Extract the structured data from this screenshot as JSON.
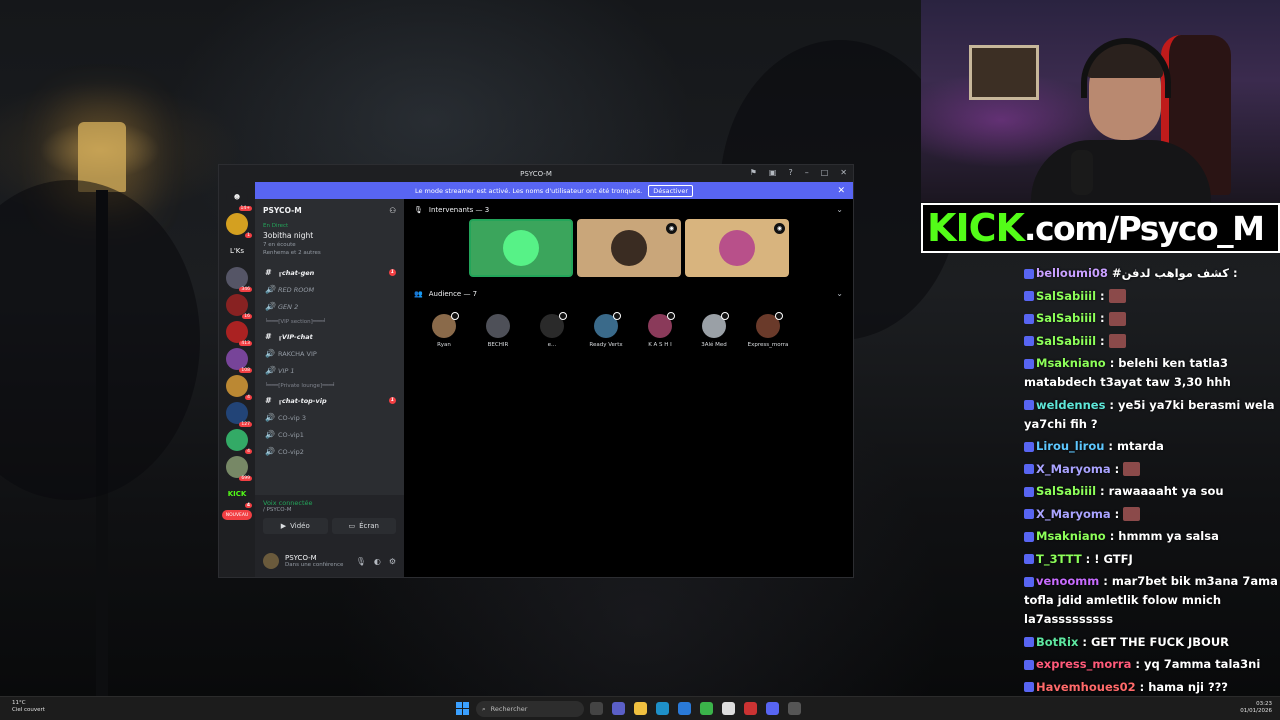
{
  "window": {
    "title": "PSYCO-M",
    "banner_text": "Le mode streamer est activé. Les noms d'utilisateur ont été tronqués.",
    "banner_button": "Désactiver"
  },
  "rail": {
    "items": [
      {
        "badge": "14+"
      },
      {
        "badge": "1"
      },
      {
        "label": "L'Ks"
      },
      {
        "badge": "346"
      },
      {
        "badge": "16"
      },
      {
        "badge": "413"
      },
      {
        "badge": "108"
      },
      {
        "badge": "4"
      },
      {
        "badge": "127"
      },
      {
        "badge": "4"
      },
      {
        "badge": "699"
      },
      {
        "label": "KICK",
        "badge": "4"
      },
      {
        "label": "NOUVEAU"
      }
    ]
  },
  "sidebar": {
    "server_name": "PSYCO-M",
    "event": {
      "status": "En Direct",
      "title": "3obitha night",
      "listening": "7 en écoute",
      "listeners": "Renhema et 2 autres"
    },
    "channels": [
      {
        "type": "text",
        "name": "╓chat-gen",
        "unread": "1",
        "style": "bold"
      },
      {
        "type": "voice",
        "name": "RED ROOM",
        "style": "italic"
      },
      {
        "type": "voice",
        "name": "GEN 2",
        "style": "italic"
      },
      {
        "type": "category",
        "name": "╘═══[VIP section]═══╛"
      },
      {
        "type": "text",
        "name": "╓VIP-chat",
        "style": "bold"
      },
      {
        "type": "voice",
        "name": "RAKCHA VIP"
      },
      {
        "type": "voice",
        "name": "VIP 1",
        "style": "italic"
      },
      {
        "type": "category",
        "name": "╘═══[Private lounge]═══╛"
      },
      {
        "type": "text",
        "name": "╓chat-top-vip",
        "unread": "1",
        "style": "bold"
      },
      {
        "type": "voice",
        "name": "CO-vip 3"
      },
      {
        "type": "voice",
        "name": "CO-vip1"
      },
      {
        "type": "voice",
        "name": "CO-vip2"
      }
    ],
    "voice": {
      "status": "Voix connectée",
      "server": "/ PSYCO-M",
      "video_label": "Vidéo",
      "screen_label": "Écran"
    },
    "user": {
      "name": "PSYCO-M",
      "status": "Dans une conférence"
    }
  },
  "stage": {
    "speakers_label": "Intervenants — 3",
    "audience_label": "Audience — 7",
    "audience": [
      {
        "name": "Ryan",
        "color": "#8a6a4a"
      },
      {
        "name": "BECHIR",
        "color": "#4e5058"
      },
      {
        "name": "e...",
        "color": "#2a2a2a"
      },
      {
        "name": "Ready Vertx",
        "color": "#3a6a8a"
      },
      {
        "name": "K A S H I",
        "color": "#8a3a5a"
      },
      {
        "name": "3Alé Med",
        "color": "#9aa0a6"
      },
      {
        "name": "Express_morra",
        "color": "#6a3a2a"
      }
    ]
  },
  "kick_banner": {
    "kick": "KICK",
    "rest": ".com/Psyco_M"
  },
  "chat": [
    {
      "user": "belloumi08",
      "color": "#c9a0ff",
      "text": "#كشف مواهب لدفن :"
    },
    {
      "user": "SalSabiiil",
      "color": "#8dff5a",
      "text": ":",
      "emote": true
    },
    {
      "user": "SalSabiiil",
      "color": "#8dff5a",
      "text": ":",
      "emote": true
    },
    {
      "user": "SalSabiiil",
      "color": "#8dff5a",
      "text": ":",
      "emote": true
    },
    {
      "user": "Msakniano",
      "color": "#8dff5a",
      "text": ": belehi ken tatla3 matabdech t3ayat taw 3,30 hhh"
    },
    {
      "user": "weldennes",
      "color": "#5ee6d8",
      "text": ": ye5i ya7ki berasmi wela ya7chi fih ?"
    },
    {
      "user": "Lirou_lirou",
      "color": "#5ec8ff",
      "text": ": mtarda"
    },
    {
      "user": "X_Maryoma",
      "color": "#a9a3ff",
      "text": ":",
      "emote": true
    },
    {
      "user": "SalSabiiil",
      "color": "#8dff5a",
      "text": ": rawaaaaht ya sou"
    },
    {
      "user": "X_Maryoma",
      "color": "#a9a3ff",
      "text": ":",
      "emote": true
    },
    {
      "user": "Msakniano",
      "color": "#8dff5a",
      "text": ": hmmm ya salsa"
    },
    {
      "user": "T_3TTT",
      "color": "#8dff5a",
      "text": ": ! GTFJ"
    },
    {
      "user": "venoomm",
      "color": "#c86cff",
      "text": ": mar7bet bik m3ana 7ama tofla jdid amletlik folow mnich la7asssssssss"
    },
    {
      "user": "BotRix",
      "color": "#5ee6a0",
      "text": ": GET THE FUCK JBOUR"
    },
    {
      "user": "express_morra",
      "color": "#ff5a7a",
      "text": ": yq 7amma tala3ni"
    },
    {
      "user": "Havemhoues02",
      "color": "#ff6a6a",
      "text": ": hama nji ???"
    }
  ],
  "taskbar": {
    "temp": "11°C",
    "weather": "Ciel couvert",
    "search_placeholder": "Rechercher",
    "time": "03:23",
    "date": "01/01/2026"
  }
}
